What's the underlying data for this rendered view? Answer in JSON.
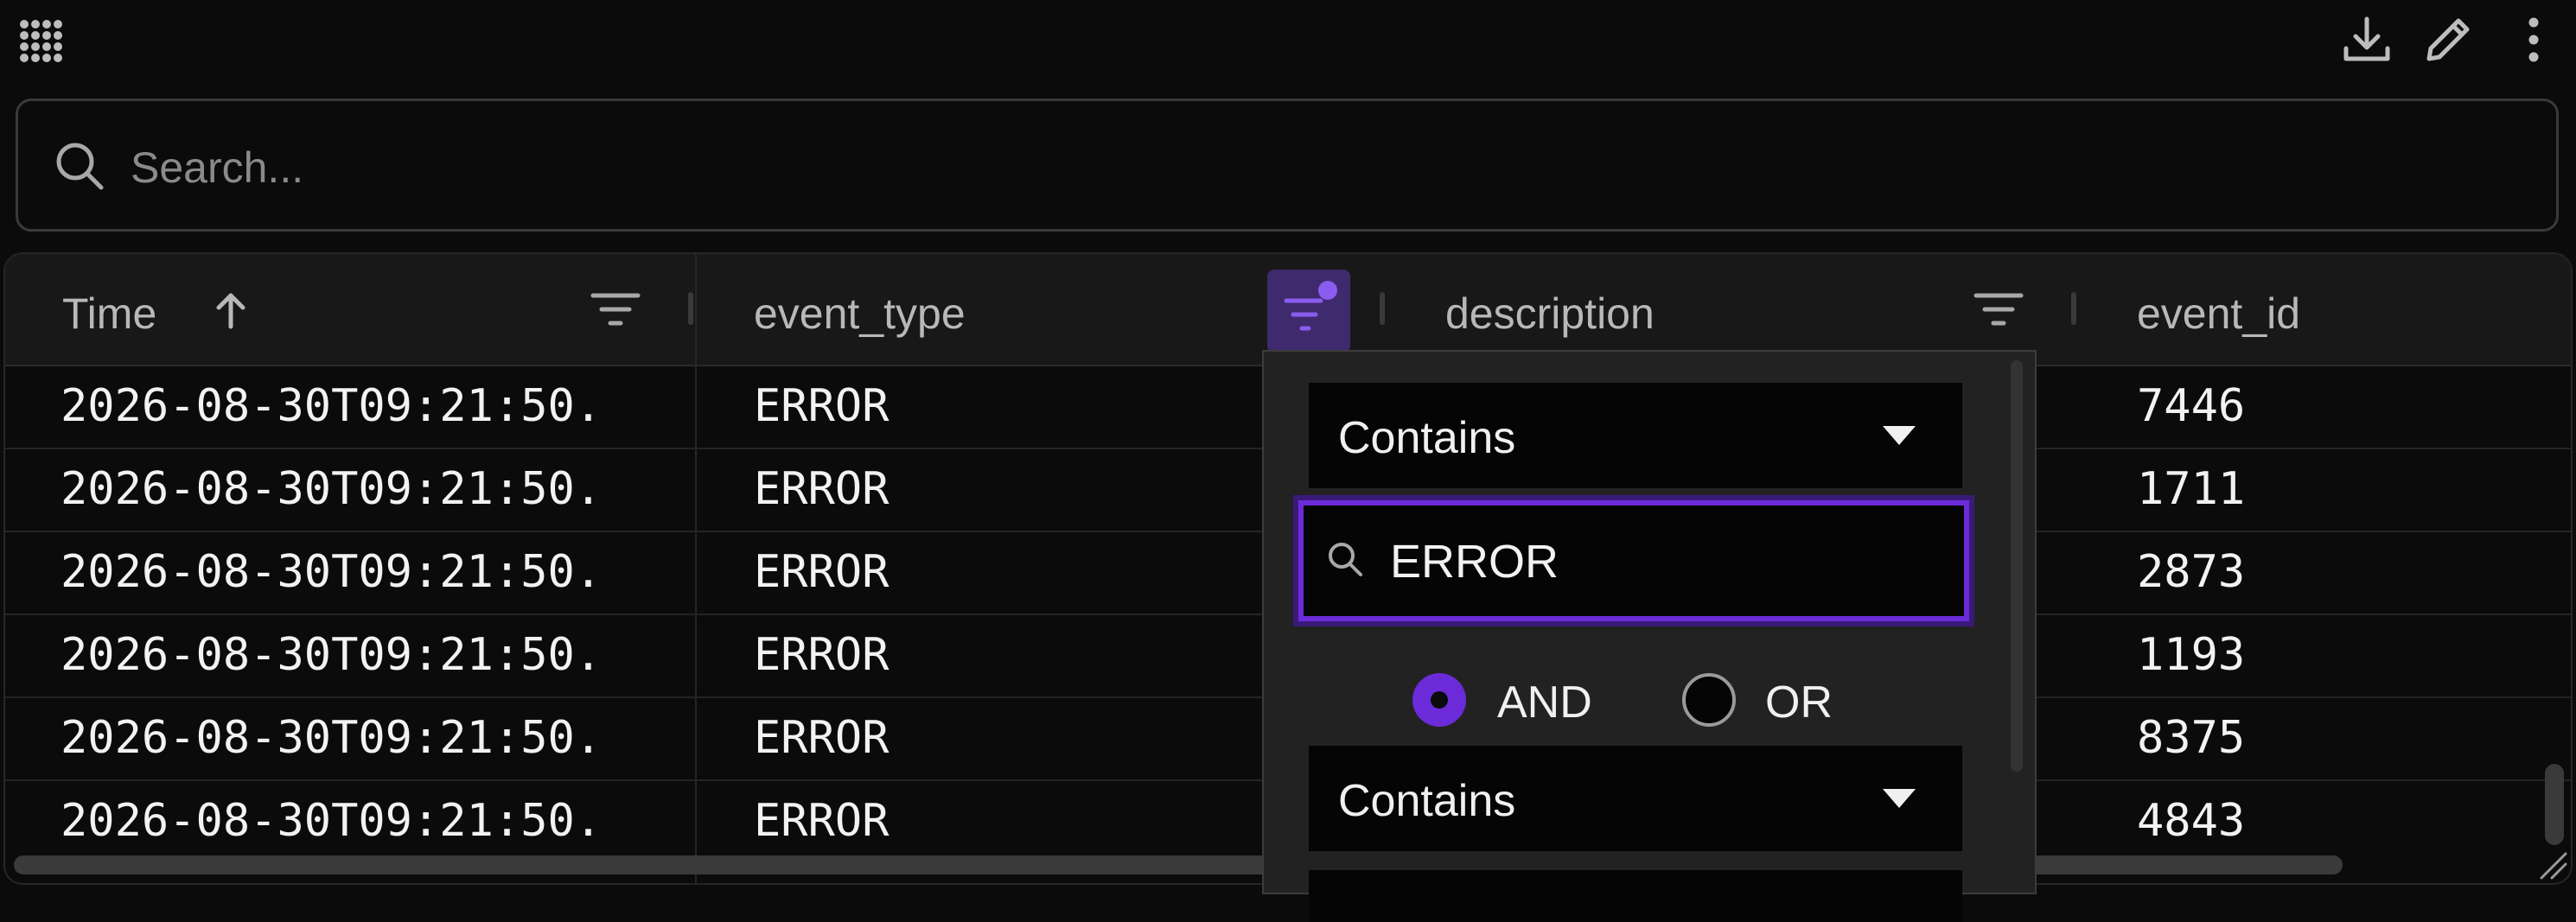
{
  "toolbar": {
    "grid_icon": "apps-grid-icon",
    "download_icon": "download-icon",
    "edit_icon": "pencil-icon",
    "menu_icon": "more-vertical-icon"
  },
  "search": {
    "placeholder": "Search..."
  },
  "columns": [
    {
      "title": "Time",
      "sort": "ascending"
    },
    {
      "title": "event_type",
      "filter_active": true
    },
    {
      "title": "description"
    },
    {
      "title": "event_id"
    }
  ],
  "rows": [
    {
      "time": "2026-08-30T09:21:50.",
      "event_type": "ERROR",
      "event_id": "7446"
    },
    {
      "time": "2026-08-30T09:21:50.",
      "event_type": "ERROR",
      "event_id": "1711"
    },
    {
      "time": "2026-08-30T09:21:50.",
      "event_type": "ERROR",
      "event_id": "2873"
    },
    {
      "time": "2026-08-30T09:21:50.",
      "event_type": "ERROR",
      "event_id": "1193"
    },
    {
      "time": "2026-08-30T09:21:50.",
      "event_type": "ERROR",
      "event_id": "8375"
    },
    {
      "time": "2026-08-30T09:21:50.",
      "event_type": "ERROR",
      "event_id": "4843"
    }
  ],
  "filter_popup": {
    "condition1": "Contains",
    "value1": "ERROR",
    "operator_and": "AND",
    "operator_or": "OR",
    "operator_selected": "AND",
    "condition2": "Contains"
  },
  "colors": {
    "accent": "#6c2bd9",
    "background": "#0b0b0b"
  }
}
